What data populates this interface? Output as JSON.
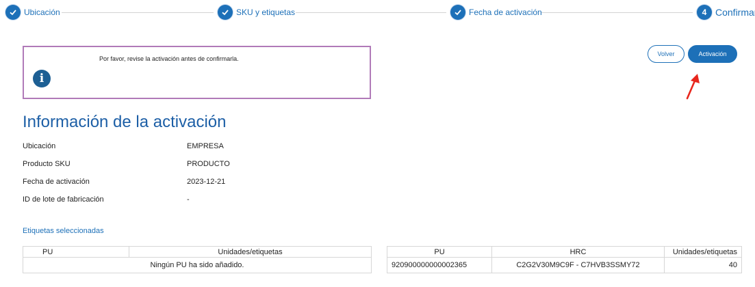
{
  "stepper": {
    "steps": [
      {
        "label": "Ubicación",
        "state": "done",
        "icon": "check-icon"
      },
      {
        "label": "SKU y etiquetas",
        "state": "done",
        "icon": "check-icon"
      },
      {
        "label": "Fecha de activación",
        "state": "done",
        "icon": "check-icon"
      },
      {
        "label": "Confirmar",
        "state": "current",
        "number": "4"
      }
    ]
  },
  "info_box": {
    "message": "Por favor, revise la activación antes de confirmarla.",
    "icon": "info-icon",
    "border_color": "#b07ab8"
  },
  "actions": {
    "back_label": "Volver",
    "activate_label": "Activación"
  },
  "details": {
    "title": "Información de la activación",
    "rows": [
      {
        "label": "Ubicación",
        "value": "EMPRESA"
      },
      {
        "label": "Producto SKU",
        "value": "PRODUCTO"
      },
      {
        "label": "Fecha de activación",
        "value": "2023-12-21"
      },
      {
        "label": "ID de lote de fabricación",
        "value": "-"
      }
    ]
  },
  "selected_labels": {
    "title": "Etiquetas seleccionadas",
    "left_table": {
      "headers": [
        "PU",
        "Unidades/etiquetas"
      ],
      "empty_message": "Ningún PU ha sido añadido."
    },
    "right_table": {
      "headers": [
        "PU",
        "HRC",
        "Unidades/etiquetas"
      ],
      "rows": [
        [
          "920900000000002365",
          "C2G2V30M9C9F - C7HVB3SSMY72",
          "40"
        ]
      ]
    }
  },
  "colors": {
    "accent": "#1d70b8",
    "title": "#1d5fa6",
    "annotation_arrow": "#e8261c"
  }
}
